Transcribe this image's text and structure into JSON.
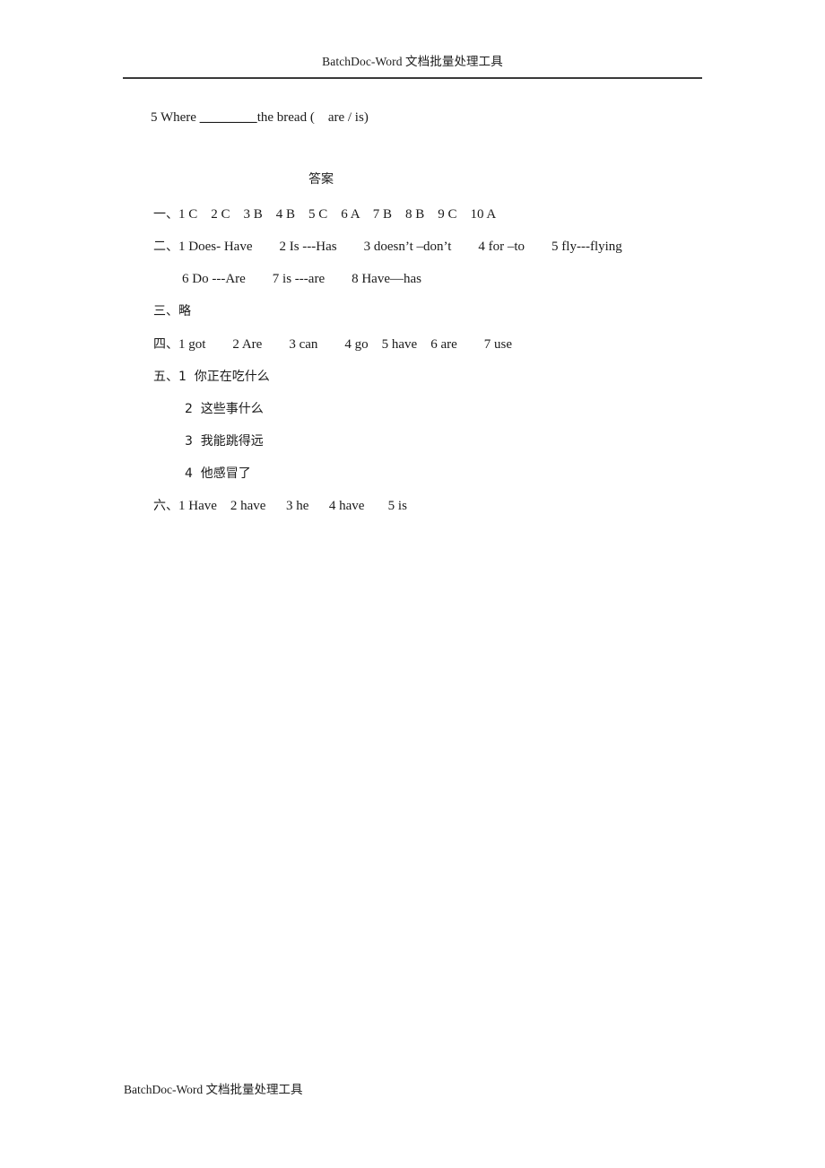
{
  "header": {
    "title": "BatchDoc-Word 文档批量处理工具"
  },
  "footer": {
    "title": "BatchDoc-Word 文档批量处理工具"
  },
  "question": {
    "prefix": "5 Where ",
    "blank": "________",
    "suffix": "the bread (    are / is)"
  },
  "answers_heading": "答案",
  "answers": [
    {
      "label": "一、",
      "text": "1 C    2 C    3 B    4 B    5 C    6 A    7 B    8 B    9 C    10 A",
      "indent": 0
    },
    {
      "label": "二、",
      "text": "1 Does- Have        2 Is ---Has        3 doesn’t –don’t        4 for –to        5 fly---flying",
      "indent": 0
    },
    {
      "label": "",
      "text": "6 Do ---Are        7 is ---are        8 Have—has",
      "indent": 1
    },
    {
      "label": "三、",
      "text": "略",
      "indent": 0
    },
    {
      "label": "四、",
      "text": "1 got        2 Are        3 can        4 go    5 have    6 are        7 use",
      "indent": 0
    },
    {
      "label": "五、",
      "text": "1  你正在吃什么",
      "indent": 0
    },
    {
      "label": "",
      "text": "2  这些事什么",
      "indent": 2
    },
    {
      "label": "",
      "text": "3  我能跳得远",
      "indent": 2
    },
    {
      "label": "",
      "text": "4  他感冒了",
      "indent": 2
    },
    {
      "label": "六、",
      "text": "1 Have    2 have      3 he      4 have       5 is",
      "indent": 0
    }
  ]
}
